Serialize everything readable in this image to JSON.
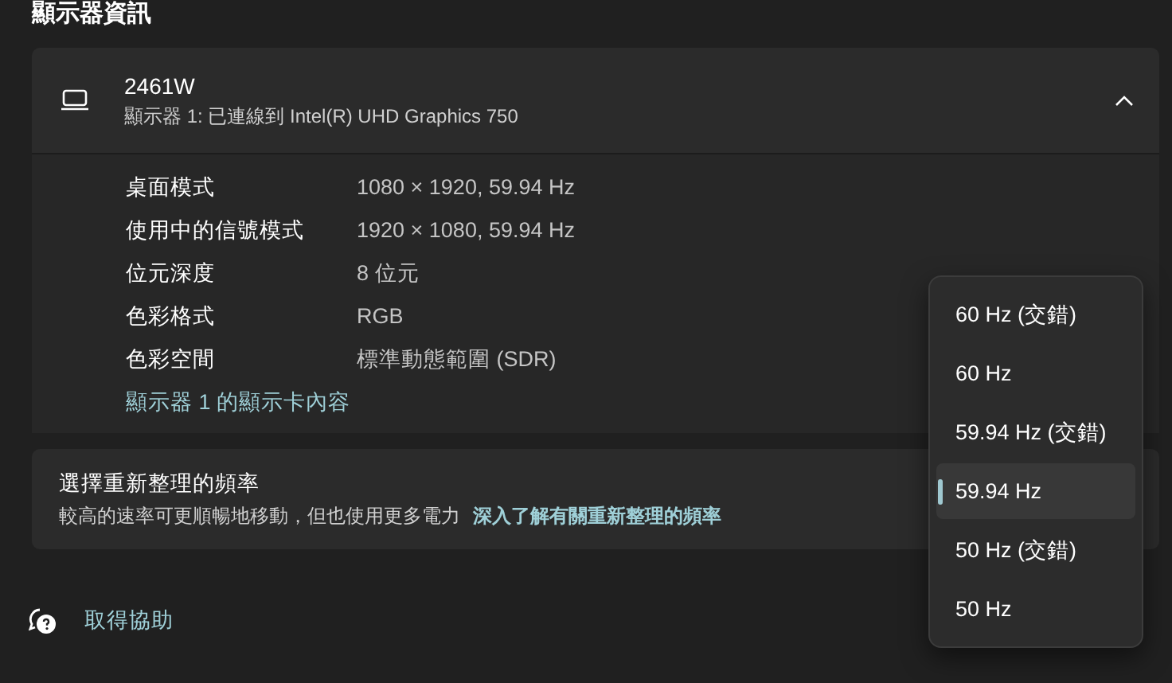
{
  "section_title": "顯示器資訊",
  "display": {
    "name": "2461W",
    "subtitle": "顯示器 1: 已連線到 Intel(R) UHD Graphics 750",
    "expanded": true,
    "details": [
      {
        "label": "桌面模式",
        "value": "1080 × 1920, 59.94 Hz"
      },
      {
        "label": "使用中的信號模式",
        "value": "1920 × 1080, 59.94 Hz"
      },
      {
        "label": "位元深度",
        "value": "8 位元"
      },
      {
        "label": "色彩格式",
        "value": "RGB"
      },
      {
        "label": "色彩空間",
        "value": "標準動態範圍 (SDR)"
      }
    ],
    "link": "顯示器 1 的顯示卡內容"
  },
  "refresh_rate": {
    "title": "選擇重新整理的頻率",
    "description": "較高的速率可更順暢地移動，但也使用更多電力",
    "link": "深入了解有關重新整理的頻率"
  },
  "refresh_menu": {
    "options": [
      {
        "label": "60 Hz (交錯)",
        "selected": false
      },
      {
        "label": "60 Hz",
        "selected": false
      },
      {
        "label": "59.94 Hz (交錯)",
        "selected": false
      },
      {
        "label": "59.94 Hz",
        "selected": true
      },
      {
        "label": "50 Hz (交錯)",
        "selected": false
      },
      {
        "label": "50 Hz",
        "selected": false
      }
    ]
  },
  "help": {
    "label": "取得協助"
  }
}
